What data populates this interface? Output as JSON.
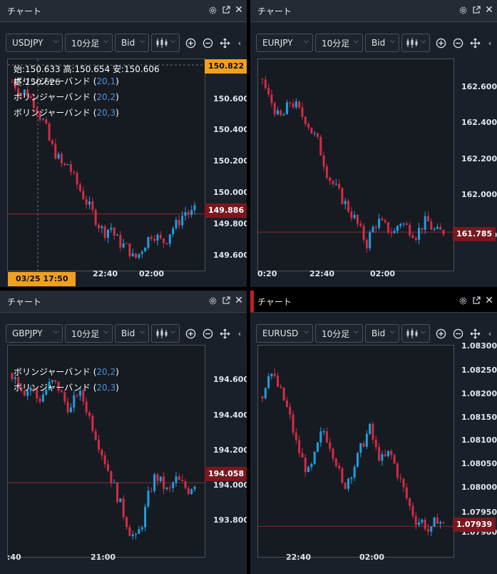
{
  "panels": [
    {
      "title": "チャート",
      "symbol": "USDJPY",
      "interval": "10分足",
      "price_type": "Bid",
      "ohlc": "始:150.633 高:150.654 安:150.606",
      "ohlc2": "終:150.626",
      "legend": [
        {
          "name": "ボリンジャーバンド",
          "params": "20,1"
        },
        {
          "name": "ボリンジャーバンド",
          "params": "20,2"
        },
        {
          "name": "ボリンジャーバンド",
          "params": "20,3"
        }
      ],
      "yticks": [
        "150.600",
        "150.400",
        "150.200",
        "150.000",
        "149.800",
        "149.600"
      ],
      "xticks": [
        "22:40",
        "02:00"
      ],
      "current_price": "149.886",
      "crosshair_price": "150.822",
      "crosshair_time": "03/25 17:50"
    },
    {
      "title": "チャート",
      "symbol": "EURJPY",
      "interval": "10分足",
      "price_type": "Bid",
      "legend": [],
      "yticks": [
        "162.600",
        "162.400",
        "162.200",
        "162.000",
        "161.800"
      ],
      "xticks": [
        "0:20",
        "22:40",
        "02:00"
      ],
      "current_price": "161.785"
    },
    {
      "title": "チャート",
      "symbol": "GBPJPY",
      "interval": "10分足",
      "price_type": "Bid",
      "legend": [
        {
          "name": "ボリンジャーバンド",
          "params": "20,2"
        },
        {
          "name": "ボリンジャーバンド",
          "params": "20,3"
        }
      ],
      "yticks": [
        "194.600",
        "194.400",
        "194.200",
        "194.000",
        "193.800"
      ],
      "xticks": [
        ":40",
        "21:00"
      ],
      "current_price": "194.058"
    },
    {
      "title": "チャート",
      "symbol": "EURUSD",
      "interval": "10分足",
      "price_type": "Bid",
      "legend": [],
      "yticks": [
        "1.08300",
        "1.08250",
        "1.08200",
        "1.08150",
        "1.08100",
        "1.08050",
        "1.08000",
        "1.07950",
        "1.07900"
      ],
      "xticks": [
        "22:40",
        "02:00"
      ],
      "current_price": "1.07939"
    }
  ],
  "colors": {
    "up": "#1e9fe0",
    "down": "#d42c45",
    "price_line": "#8a2a30",
    "accent": "#c41a2a",
    "crosshair_tag": "#f0a020"
  },
  "icons": {
    "settings": "gear-icon",
    "popout": "popout-icon",
    "close": "close-icon",
    "candle": "candle-icon",
    "zoom_in": "zoom-in-icon",
    "zoom_out": "zoom-out-icon",
    "move": "move-icon"
  },
  "chart_data": [
    {
      "type": "candlestick",
      "symbol": "USDJPY",
      "ylim": [
        149.55,
        150.78
      ],
      "current": 149.886,
      "trend": [
        150.65,
        150.62,
        150.58,
        150.6,
        150.55,
        150.52,
        150.45,
        150.4,
        150.3,
        150.25,
        150.2,
        150.15,
        150.18,
        150.1,
        150.05,
        150.0,
        149.95,
        149.9,
        149.85,
        149.8,
        149.78,
        149.82,
        149.75,
        149.72,
        149.7,
        149.68,
        149.62,
        149.65,
        149.7,
        149.74,
        149.78,
        149.75,
        149.72,
        149.74,
        149.8,
        149.82,
        149.86,
        149.9,
        149.88,
        149.9
      ]
    },
    {
      "type": "candlestick",
      "symbol": "EURJPY",
      "ylim": [
        161.56,
        162.76
      ],
      "current": 161.785,
      "trend": [
        162.65,
        162.55,
        162.5,
        162.42,
        162.45,
        162.52,
        162.5,
        162.45,
        162.42,
        162.35,
        162.3,
        162.2,
        162.1,
        162.05,
        162.0,
        161.95,
        161.9,
        161.85,
        161.78,
        161.72,
        161.8,
        161.85,
        161.82,
        161.8,
        161.78,
        161.85,
        161.82,
        161.8,
        161.77,
        161.82,
        161.85,
        161.8,
        161.78,
        161.79
      ]
    },
    {
      "type": "candlestick",
      "symbol": "GBPJPY",
      "ylim": [
        193.65,
        194.8
      ],
      "current": 194.058,
      "trend": [
        194.65,
        194.6,
        194.55,
        194.58,
        194.5,
        194.55,
        194.6,
        194.58,
        194.5,
        194.45,
        194.55,
        194.5,
        194.4,
        194.3,
        194.2,
        194.1,
        194.0,
        193.9,
        193.8,
        193.75,
        193.85,
        194.0,
        194.1,
        194.05,
        194.0,
        194.08,
        194.05,
        194.02,
        194.06
      ]
    },
    {
      "type": "candlestick",
      "symbol": "EURUSD",
      "ylim": [
        1.0787,
        1.0833
      ],
      "current": 1.07939,
      "trend": [
        1.0822,
        1.0828,
        1.0825,
        1.0822,
        1.0818,
        1.0812,
        1.0808,
        1.0805,
        1.081,
        1.0815,
        1.0812,
        1.0808,
        1.0802,
        1.0805,
        1.0808,
        1.0812,
        1.0815,
        1.081,
        1.0808,
        1.081,
        1.0806,
        1.0802,
        1.0798,
        1.0795,
        1.0795,
        1.0792,
        1.0796,
        1.0794
      ]
    }
  ]
}
